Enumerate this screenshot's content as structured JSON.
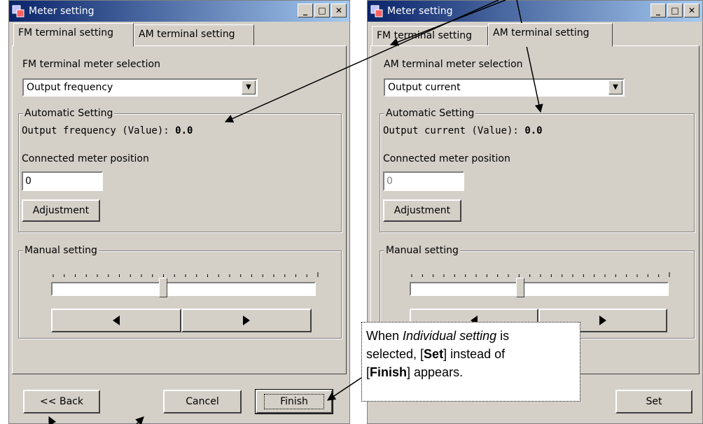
{
  "left_window": {
    "title": "Meter setting",
    "tabs": [
      {
        "label": "FM terminal setting"
      },
      {
        "label": "AM terminal setting"
      }
    ],
    "meter_selection_label": "FM terminal meter selection",
    "meter_selection_value": "Output frequency",
    "automatic_group_label": "Automatic Setting",
    "value_label": "Output frequency (Value):",
    "value": "0.0",
    "position_label": "Connected meter position",
    "position_value": "0",
    "adjust_label": "Adjustment",
    "manual_group_label": "Manual setting",
    "back_label": "<< Back",
    "cancel_label": "Cancel",
    "finish_label": "Finish"
  },
  "right_window": {
    "title": "Meter setting",
    "tabs": [
      {
        "label": "FM terminal setting"
      },
      {
        "label": "AM terminal setting"
      }
    ],
    "meter_selection_label": "AM terminal meter selection",
    "meter_selection_value": "Output current",
    "automatic_group_label": "Automatic Setting",
    "value_label": "Output current (Value):",
    "value": "0.0",
    "position_label": "Connected meter position",
    "position_value": "0",
    "adjust_label": "Adjustment",
    "manual_group_label": "Manual setting",
    "set_label": "Set"
  },
  "callout": {
    "line1_a": "When ",
    "line1_italic": "Individual setting",
    "line1_b": " is",
    "line2_a": "selected, [",
    "line2_bold": "Set",
    "line2_b": "] instead of",
    "line3_a": "[",
    "line3_bold": "Finish",
    "line3_b": "] appears."
  },
  "slider": {
    "level": 0.42
  },
  "colors": {
    "titlebar_start": "#0a246a",
    "titlebar_end": "#a6caf0",
    "face": "#d4d0c8"
  }
}
